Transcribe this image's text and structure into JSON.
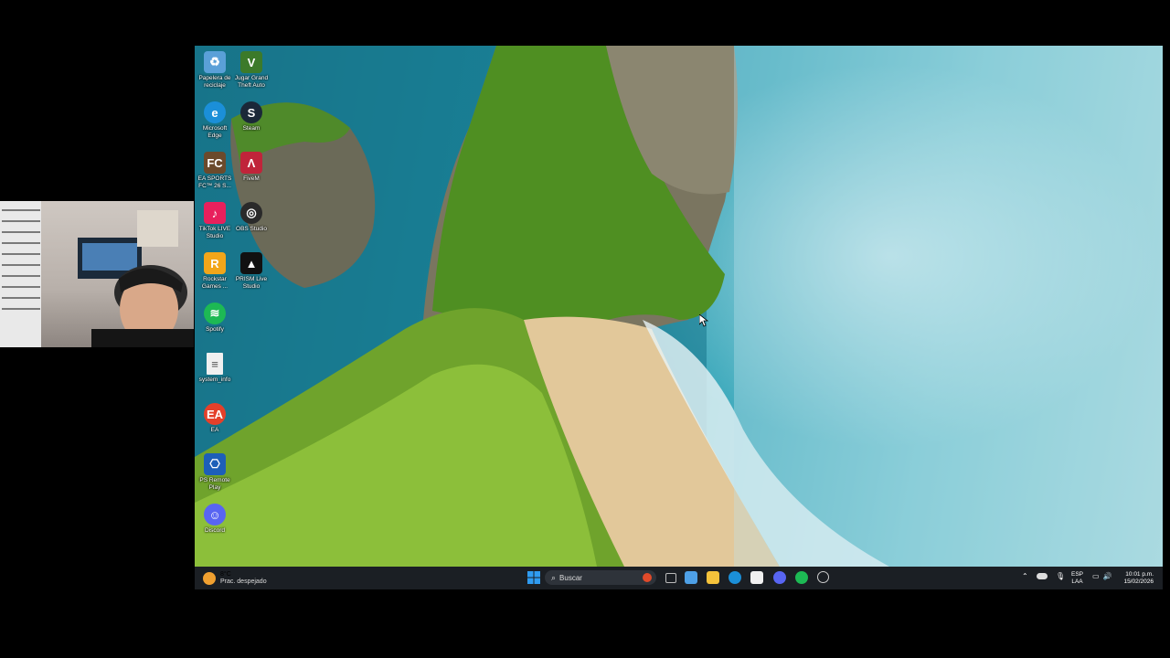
{
  "desktop_icons": [
    {
      "label": "Papelera de\nreciclaje",
      "icon": "recycle-bin-icon",
      "color": "#5aa0d8"
    },
    {
      "label": "Jugar Grand\nTheft Auto",
      "icon": "gta-icon",
      "color": "#3c7a2a"
    },
    {
      "label": "Microsoft\nEdge",
      "icon": "edge-icon",
      "color": "#1b8fd8"
    },
    {
      "label": "Steam",
      "icon": "steam-icon",
      "color": "#1b2838"
    },
    {
      "label": "EA SPORTS\nFC™ 26 S...",
      "icon": "ea-fc-icon",
      "color": "#6b4a2c"
    },
    {
      "label": "FiveM",
      "icon": "fivem-icon",
      "color": "#c0243a"
    },
    {
      "label": "TikTok LIVE\nStudio",
      "icon": "tiktok-icon",
      "color": "#e8205c"
    },
    {
      "label": "OBS Studio",
      "icon": "obs-icon",
      "color": "#2a2a2a"
    },
    {
      "label": "Rockstar\nGames ...",
      "icon": "rockstar-icon",
      "color": "#f2a61a"
    },
    {
      "label": "PRISM Live\nStudio",
      "icon": "prism-icon",
      "color": "#111111"
    },
    {
      "label": "Spotify",
      "icon": "spotify-icon",
      "color": "#1db954"
    },
    {
      "label": "system_info",
      "icon": "file-icon",
      "color": "#f0f0f0"
    },
    {
      "label": "EA",
      "icon": "ea-icon",
      "color": "#e4402a"
    },
    {
      "label": "PS Remote\nPlay",
      "icon": "ps-remote-play-icon",
      "color": "#1d5fb8"
    },
    {
      "label": "Discord",
      "icon": "discord-icon",
      "color": "#5865f2"
    }
  ],
  "taskbar": {
    "weather_temp": "8°C",
    "weather_desc": "Prac. despejado",
    "search_placeholder": "Buscar",
    "language_top": "ESP",
    "language_bottom": "LAA",
    "time": "10:01 p.m.",
    "date": "15/02/2026",
    "pinned": [
      {
        "icon": "windows-start-icon",
        "color": "#2f9bf0"
      },
      {
        "icon": "task-view-icon",
        "color": "#bbbbbb"
      },
      {
        "icon": "widgets-icon",
        "color": "#4ea0e6"
      },
      {
        "icon": "file-explorer-icon",
        "color": "#f5c33b"
      },
      {
        "icon": "edge-icon",
        "color": "#1b8fd8"
      },
      {
        "icon": "microsoft-store-icon",
        "color": "#f0f0f0"
      },
      {
        "icon": "discord-icon",
        "color": "#5865f2"
      },
      {
        "icon": "spotify-icon",
        "color": "#1db954"
      },
      {
        "icon": "obs-icon",
        "color": "#cccccc"
      }
    ]
  }
}
